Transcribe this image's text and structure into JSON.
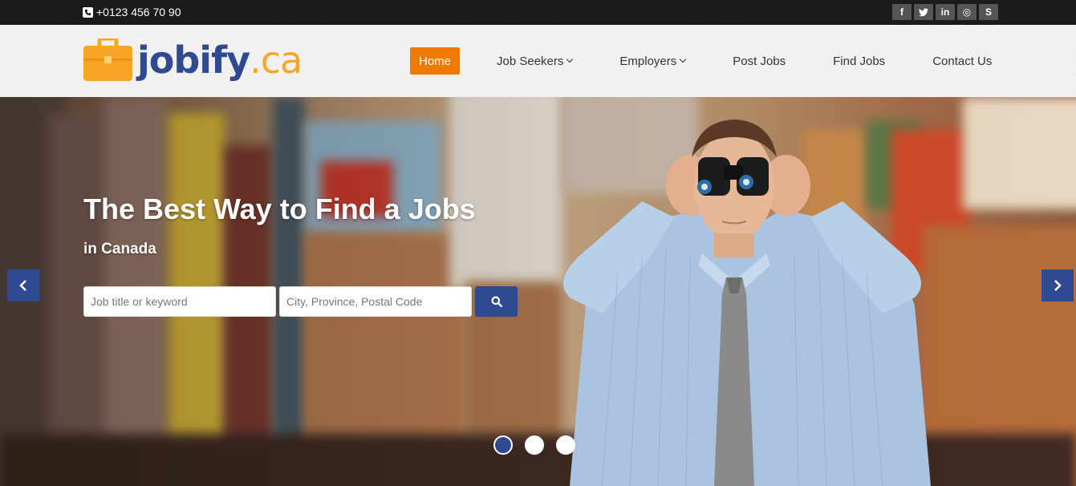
{
  "topbar": {
    "phone": "+0123 456 70 90",
    "social": [
      {
        "icon": "facebook-icon",
        "glyph": "f"
      },
      {
        "icon": "twitter-icon",
        "glyph": "t"
      },
      {
        "icon": "linkedin-icon",
        "glyph": "in"
      },
      {
        "icon": "dribbble-icon",
        "glyph": "◎"
      },
      {
        "icon": "skype-icon",
        "glyph": "S"
      }
    ]
  },
  "logo": {
    "main": "jobify",
    "tld": ".ca",
    "icon": "briefcase-icon"
  },
  "nav": {
    "items": [
      {
        "label": "Home",
        "active": true,
        "dropdown": false
      },
      {
        "label": "Job Seekers",
        "active": false,
        "dropdown": true
      },
      {
        "label": "Employers",
        "active": false,
        "dropdown": true
      },
      {
        "label": "Post Jobs",
        "active": false,
        "dropdown": false
      },
      {
        "label": "Find Jobs",
        "active": false,
        "dropdown": false
      },
      {
        "label": "Contact Us",
        "active": false,
        "dropdown": false
      }
    ]
  },
  "hero": {
    "headline": "The Best Way to Find a Jobs",
    "subline": "in Canada",
    "search": {
      "keyword_placeholder": "Job title or keyword",
      "location_placeholder": "City, Province, Postal Code"
    },
    "slider": {
      "slides": 3,
      "active": 0
    }
  },
  "colors": {
    "brand_blue": "#2f4a91",
    "brand_orange": "#ee7b00",
    "logo_yellow": "#f6a623"
  }
}
